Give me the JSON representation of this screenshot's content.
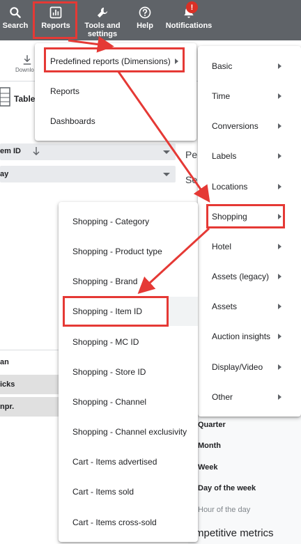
{
  "topbar": {
    "search": "Search",
    "reports": "Reports",
    "tools": "Tools and settings",
    "help": "Help",
    "notifications": "Notifications",
    "notification_badge": "!"
  },
  "background": {
    "download": "Downlo",
    "table": "Table",
    "item_id": "em ID",
    "day": "ay",
    "pe": "Pe",
    "se": "Se",
    "row_an": "an",
    "row_clicks": "icks",
    "row_impr": "npr.",
    "time_quarter": "Quarter",
    "time_month": "Month",
    "time_week": "Week",
    "time_day_of_week": "Day of the week",
    "time_hour": "Hour of the day",
    "competitive": "mpetitive metrics"
  },
  "reports_menu": {
    "items": [
      "Predefined reports (Dimensions)",
      "Reports",
      "Dashboards"
    ]
  },
  "categories_menu": {
    "items": [
      "Basic",
      "Time",
      "Conversions",
      "Labels",
      "Locations",
      "Shopping",
      "Hotel",
      "Assets (legacy)",
      "Assets",
      "Auction insights",
      "Display/Video",
      "Other"
    ]
  },
  "shopping_menu": {
    "items": [
      "Shopping - Category",
      "Shopping - Product type",
      "Shopping - Brand",
      "Shopping - Item ID",
      "Shopping - MC ID",
      "Shopping - Store ID",
      "Shopping - Channel",
      "Shopping - Channel exclusivity",
      "Cart - Items advertised",
      "Cart - Items sold",
      "Cart - Items cross-sold"
    ]
  },
  "colors": {
    "topbar": "#5f6368",
    "highlight": "#e53935",
    "badge": "#d93025"
  }
}
